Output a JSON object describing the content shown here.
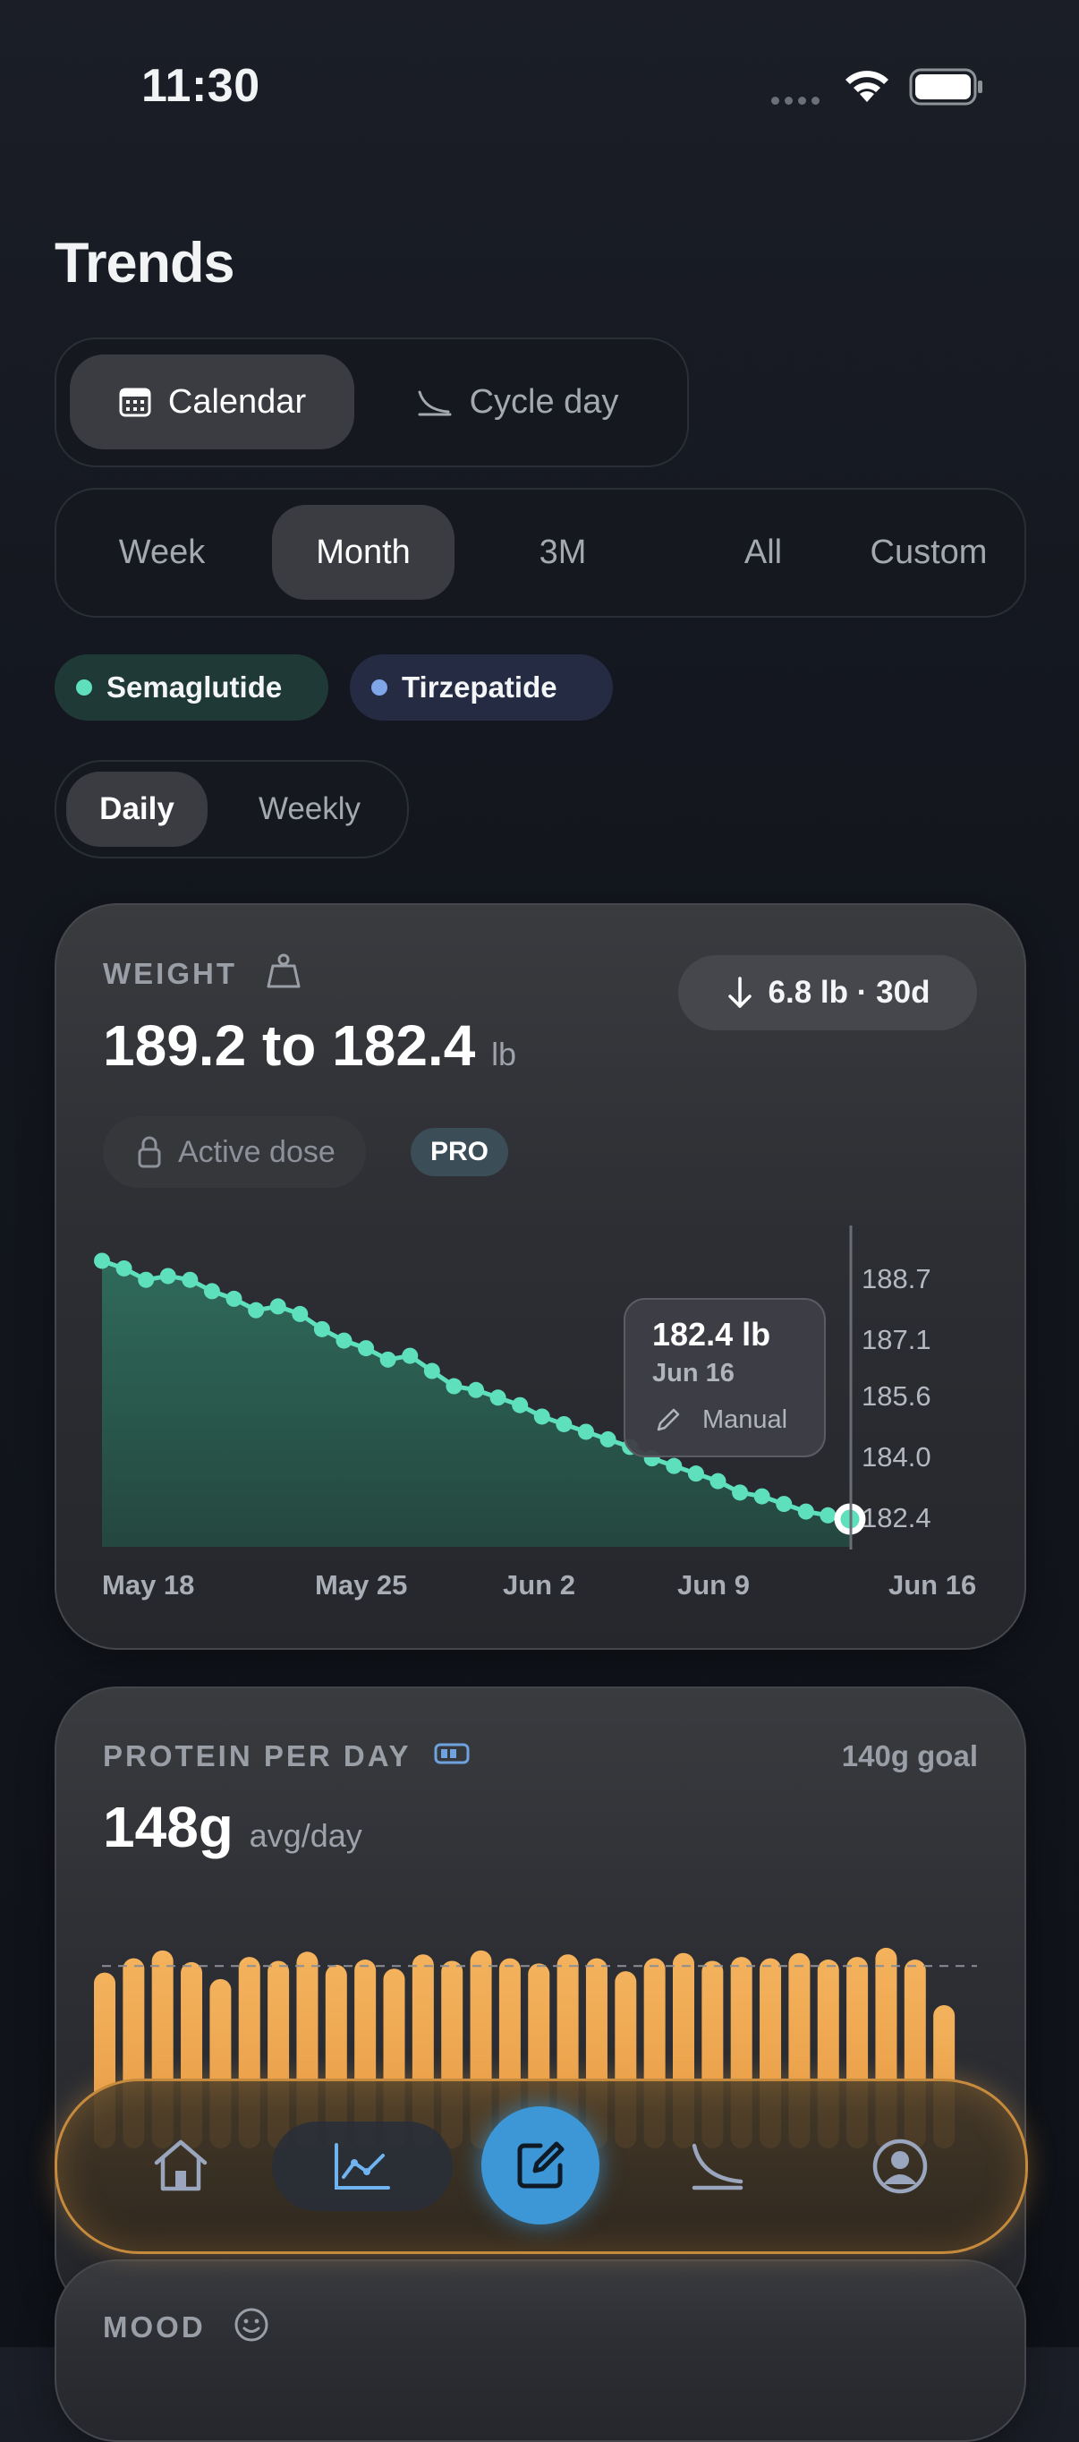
{
  "status_bar": {
    "time": "11:30"
  },
  "page": {
    "title": "Trends"
  },
  "axis_mode": {
    "options": [
      {
        "label": "Calendar",
        "icon": "calendar-icon",
        "active": true
      },
      {
        "label": "Cycle day",
        "icon": "cycle-curve-icon",
        "active": false
      }
    ]
  },
  "range": {
    "options": [
      "Week",
      "Month",
      "3M",
      "All",
      "Custom"
    ],
    "selected": "Month"
  },
  "medications": [
    {
      "label": "Semaglutide",
      "color": "#5fe0bd"
    },
    {
      "label": "Tirzepatide",
      "color": "#7fa6e8"
    }
  ],
  "granularity": {
    "options": [
      "Daily",
      "Weekly"
    ],
    "selected": "Daily"
  },
  "weight_card": {
    "label": "WEIGHT",
    "icon": "scale-icon",
    "range_text": "189.2 to 182.4",
    "unit": "lb",
    "delta": "6.8 lb · 30d",
    "active_dose_label": "Active dose",
    "pro_label": "PRO",
    "tooltip": {
      "value": "182.4 lb",
      "date": "Jun 16",
      "source": "Manual"
    }
  },
  "protein_card": {
    "label": "PROTEIN PER DAY",
    "goal": "140g goal",
    "value": "148g",
    "unit": "avg/day"
  },
  "mood_card": {
    "label": "MOOD"
  },
  "chart_data": [
    {
      "type": "area",
      "title": "WEIGHT",
      "y_unit": "lb",
      "y_ticks": [
        "188.7",
        "187.1",
        "185.6",
        "184.0",
        "182.4"
      ],
      "x_ticks": [
        "May 18",
        "May 25",
        "Jun 2",
        "Jun 9",
        "Jun 16"
      ],
      "ylim": [
        181.6,
        189.4
      ],
      "series": [
        {
          "color": "#5fe0bd",
          "values": [
            189.2,
            189.0,
            188.7,
            188.8,
            188.7,
            188.4,
            188.2,
            187.9,
            188.0,
            187.8,
            187.4,
            187.1,
            186.9,
            186.6,
            186.7,
            186.3,
            185.9,
            185.8,
            185.6,
            185.4,
            185.1,
            184.9,
            184.7,
            184.5,
            184.3,
            184.0,
            183.8,
            183.6,
            183.4,
            183.1,
            183.0,
            182.8,
            182.6,
            182.5,
            182.4
          ]
        }
      ]
    },
    {
      "type": "bar",
      "title": "PROTEIN PER DAY",
      "goal_line": 140,
      "ylim": [
        0,
        175
      ],
      "series": [
        {
          "color": "#f0a64e",
          "values": [
            135,
            146,
            152,
            143,
            130,
            147,
            144,
            151,
            141,
            145,
            138,
            149,
            144,
            152,
            146,
            142,
            149,
            146,
            136,
            146,
            150,
            144,
            147,
            146,
            150,
            145,
            147,
            154,
            145,
            110
          ]
        }
      ]
    }
  ]
}
